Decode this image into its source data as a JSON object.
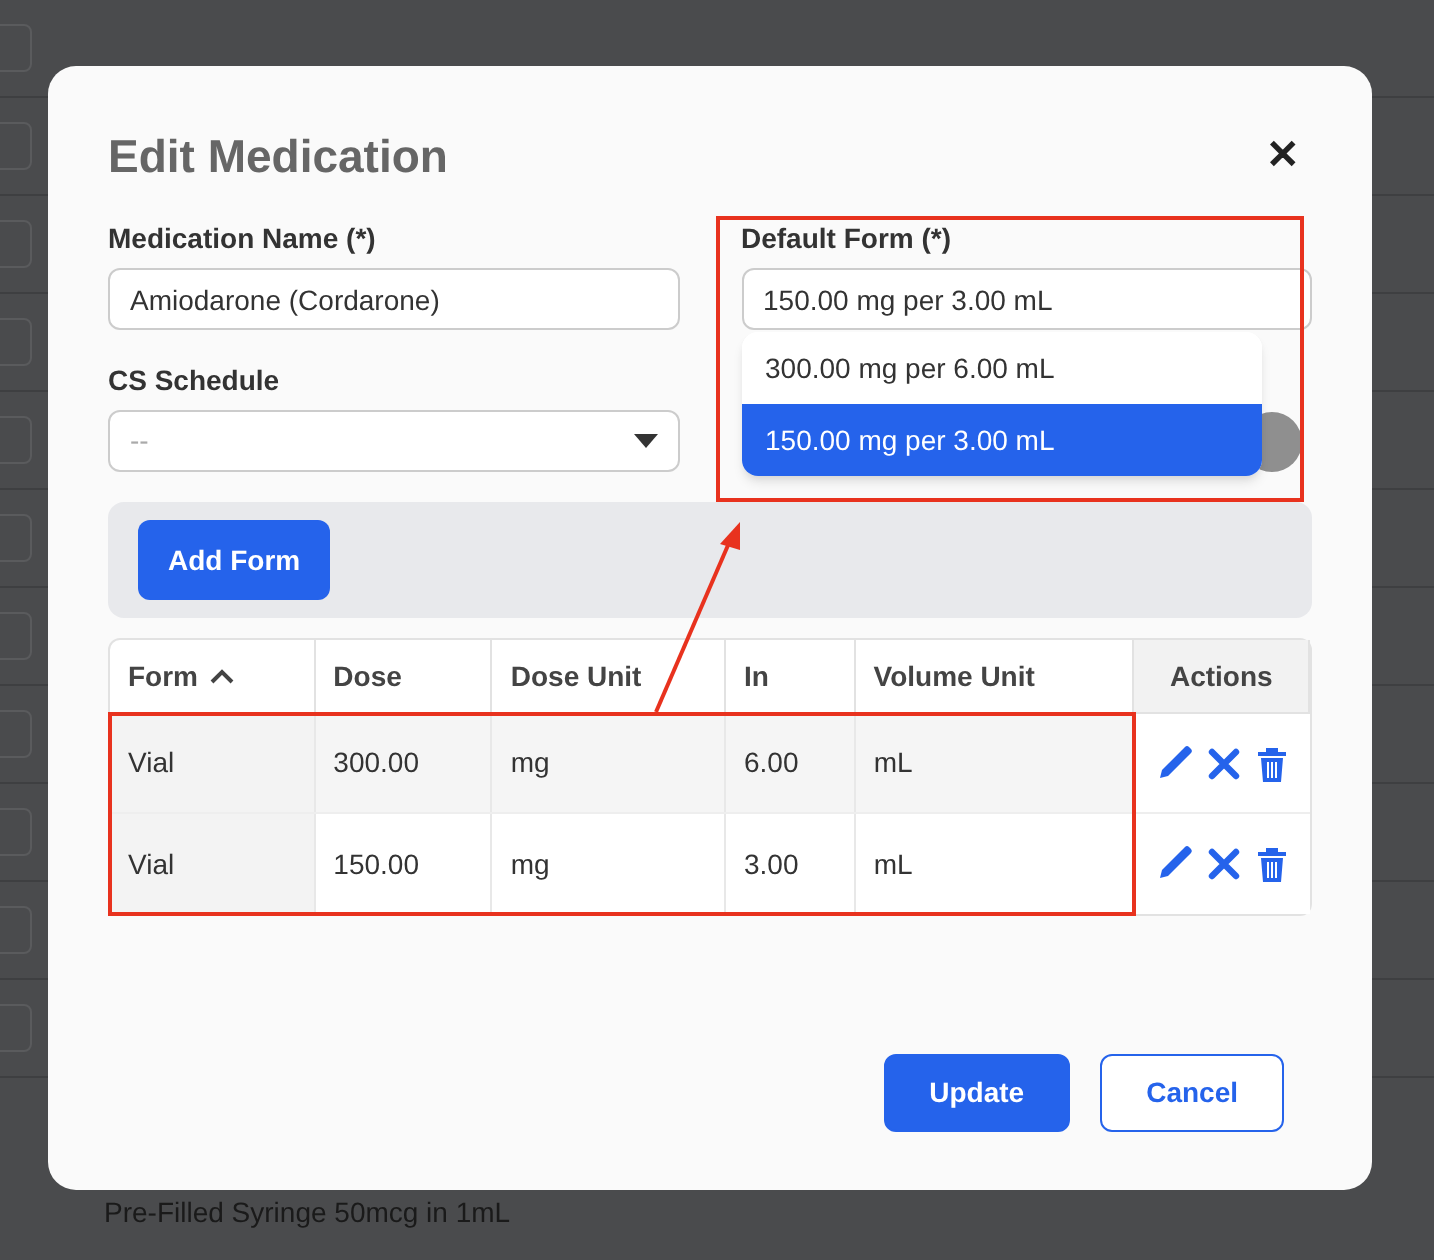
{
  "background": {
    "row_text": "Pre-Filled Syringe 50mcg in 1mL"
  },
  "modal": {
    "title": "Edit Medication",
    "close": "✕",
    "medication_name": {
      "label": "Medication Name (*)",
      "value": "Amiodarone (Cordarone)"
    },
    "cs_schedule": {
      "label": "CS Schedule",
      "placeholder": "--"
    },
    "default_form": {
      "label": "Default Form (*)",
      "value": "150.00 mg per 3.00 mL",
      "expanded": true,
      "options": [
        {
          "label": "300.00 mg per 6.00 mL",
          "selected": false
        },
        {
          "label": "150.00 mg per 3.00 mL",
          "selected": true
        }
      ]
    },
    "add_form_button": "Add Form",
    "table": {
      "columns": [
        {
          "label": "Form",
          "sorted": true
        },
        {
          "label": "Dose"
        },
        {
          "label": "Dose Unit"
        },
        {
          "label": "In"
        },
        {
          "label": "Volume Unit"
        },
        {
          "label": "Actions"
        }
      ],
      "rows": [
        [
          "Vial",
          "300.00",
          "mg",
          "6.00",
          "mL"
        ],
        [
          "Vial",
          "150.00",
          "mg",
          "3.00",
          "mL"
        ]
      ]
    },
    "buttons": [
      {
        "label": "Update",
        "kind": "primary"
      },
      {
        "label": "Cancel",
        "kind": "secondary"
      }
    ]
  }
}
